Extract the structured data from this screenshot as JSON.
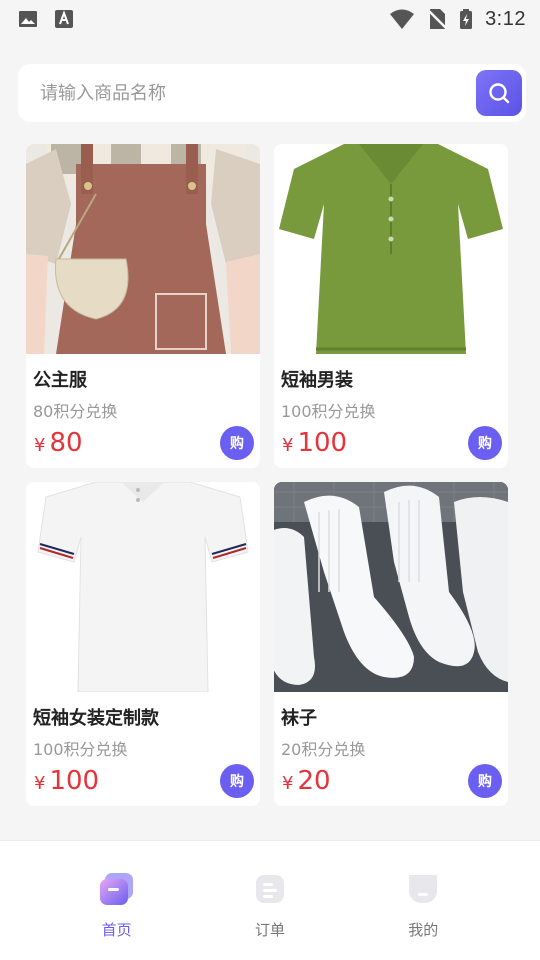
{
  "status_bar": {
    "time": "3:12",
    "icons": [
      "image-icon",
      "text-a-icon",
      "wifi-icon",
      "no-sim-icon",
      "battery-charging-icon"
    ]
  },
  "search": {
    "placeholder": "请输入商品名称",
    "icon": "search-icon",
    "accent": "#6a5ff0"
  },
  "products": [
    {
      "title": "公主服",
      "points": "80积分兑换",
      "currency": "¥",
      "price": "80",
      "buy_label": "购",
      "image": "pinafore-dress-photo"
    },
    {
      "title": "短袖男装",
      "points": "100积分兑换",
      "currency": "¥",
      "price": "100",
      "buy_label": "购",
      "image": "green-polo-shirt-photo"
    },
    {
      "title": "短袖女装定制款",
      "points": "100积分兑换",
      "currency": "¥",
      "price": "100",
      "buy_label": "购",
      "image": "white-polo-shirt-photo"
    },
    {
      "title": "袜子",
      "points": "20积分兑换",
      "currency": "¥",
      "price": "20",
      "buy_label": "购",
      "image": "white-socks-photo"
    }
  ],
  "bottom_nav": [
    {
      "label": "首页",
      "icon": "home-icon",
      "active": true
    },
    {
      "label": "订单",
      "icon": "orders-icon",
      "active": false
    },
    {
      "label": "我的",
      "icon": "profile-icon",
      "active": false
    }
  ],
  "colors": {
    "price": "#e8323a",
    "accent": "#6a5ff0",
    "background": "#f5f5f5"
  }
}
